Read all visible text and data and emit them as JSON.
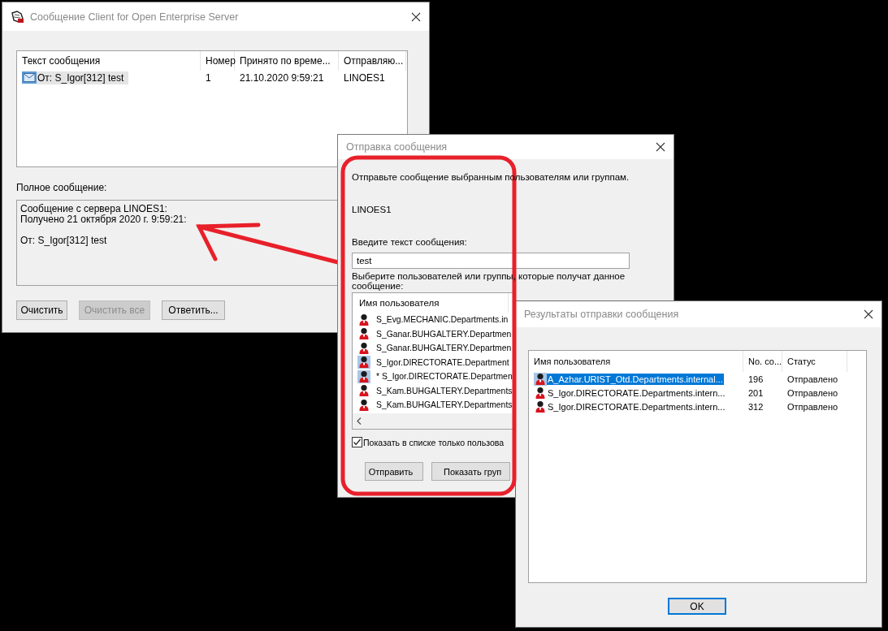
{
  "message_window": {
    "title": "Сообщение Client for Open Enterprise Server",
    "columns": [
      "Текст сообщения",
      "Номер",
      "Принято по време...",
      "Отправляю..."
    ],
    "rows": [
      {
        "text": "От: S_Igor[312] test",
        "number": "1",
        "received": "21.10.2020 9:59:21",
        "sender": "LINOES1",
        "selected": true
      }
    ],
    "full_message_label": "Полное сообщение:",
    "full_message": {
      "header": [
        "Сообщение с сервера LINOES1:",
        "Получено 21 октября 2020 г. 9:59:21:"
      ],
      "body": "От: S_Igor[312] test"
    },
    "buttons": [
      {
        "label": "Очистить",
        "disabled": false
      },
      {
        "label": "Очистить все",
        "disabled": true
      },
      {
        "label": "Ответить...",
        "disabled": false
      }
    ]
  },
  "send_dialog": {
    "title": "Отправка сообщения",
    "instruction": "Отправьте сообщение выбранным пользователям или группам.",
    "server": "LINOES1",
    "message_label": "Введите текст сообщения:",
    "message_value": "test",
    "recipients_label": "Выберите пользователей или группы, которые получат данное сообщение:",
    "list_column": "Имя пользователя",
    "users": [
      {
        "name": "S_Evg.MECHANIC.Departments.in",
        "selected": false
      },
      {
        "name": "S_Ganar.BUHGALTERY.Departmen",
        "selected": false
      },
      {
        "name": "S_Ganar.BUHGALTERY.Departmen",
        "selected": false
      },
      {
        "name": "S_Igor.DIRECTORATE.Department",
        "selected": true
      },
      {
        "name": "* S_Igor.DIRECTORATE.Departmen",
        "selected": true
      },
      {
        "name": "S_Kam.BUHGALTERY.Departments",
        "selected": false
      },
      {
        "name": "S_Kam.BUHGALTERY.Departments",
        "selected": false
      }
    ],
    "show_only": {
      "label": "Показать в списке только пользова",
      "checked": true
    },
    "buttons": [
      "Отправить",
      "Показать груп"
    ]
  },
  "results_dialog": {
    "title": "Результаты отправки сообщения",
    "columns": [
      "Имя пользователя",
      "No. со...",
      "Статус"
    ],
    "rows": [
      {
        "name": "A_Azhar.URIST_Otd.Departments.internal...",
        "number": "196",
        "status": "Отправлено",
        "selected": true
      },
      {
        "name": "S_Igor.DIRECTORATE.Departments.intern...",
        "number": "201",
        "status": "Отправлено",
        "selected": false
      },
      {
        "name": "S_Igor.DIRECTORATE.Departments.intern...",
        "number": "312",
        "status": "Отправлено",
        "selected": false
      }
    ],
    "ok_button": "OK"
  }
}
